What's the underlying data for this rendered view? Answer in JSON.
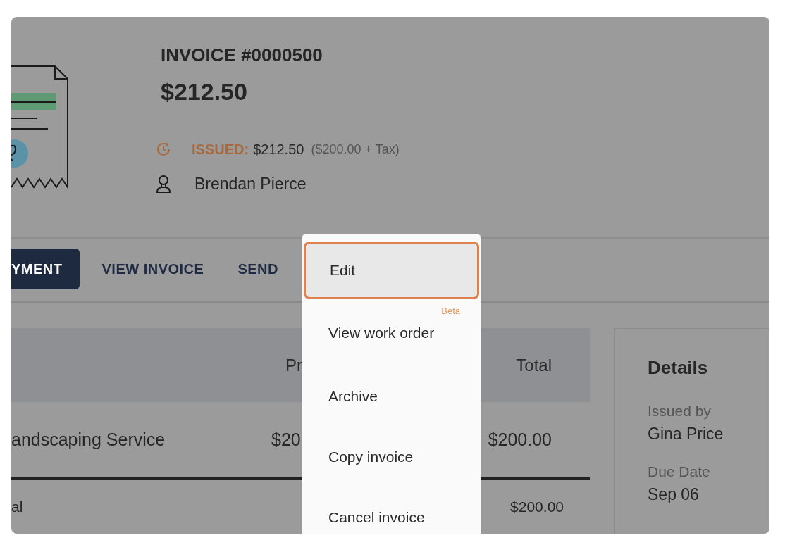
{
  "invoice": {
    "title": "INVOICE #0000500",
    "amount": "$212.50",
    "status": {
      "label": "ISSUED:",
      "amount": "$212.50",
      "breakdown": "($200.00 + Tax)"
    },
    "client": "Brendan Pierce"
  },
  "actions": [
    {
      "label": "YMENT",
      "kind": "primary"
    },
    {
      "label": "VIEW INVOICE",
      "kind": "link"
    },
    {
      "label": "SEND",
      "kind": "link"
    }
  ],
  "table": {
    "columns": [
      "",
      "Pr",
      "Total"
    ],
    "rows": [
      {
        "cells": [
          "andscaping Service",
          "$20",
          "$200.00"
        ]
      }
    ],
    "subtotal": {
      "label": "al",
      "total": "$200.00"
    }
  },
  "details": {
    "title": "Details",
    "fields": [
      {
        "label": "Issued by",
        "value": "Gina Price"
      },
      {
        "label": "Due Date",
        "value": "Sep 06"
      }
    ]
  },
  "menu": {
    "items": [
      {
        "label": "Edit",
        "selected": true
      },
      {
        "label": "View work order",
        "selected": false,
        "badge": "Beta"
      },
      {
        "label": "Archive",
        "selected": false
      },
      {
        "label": "Copy invoice",
        "selected": false
      },
      {
        "label": "Cancel invoice",
        "selected": false
      }
    ]
  }
}
